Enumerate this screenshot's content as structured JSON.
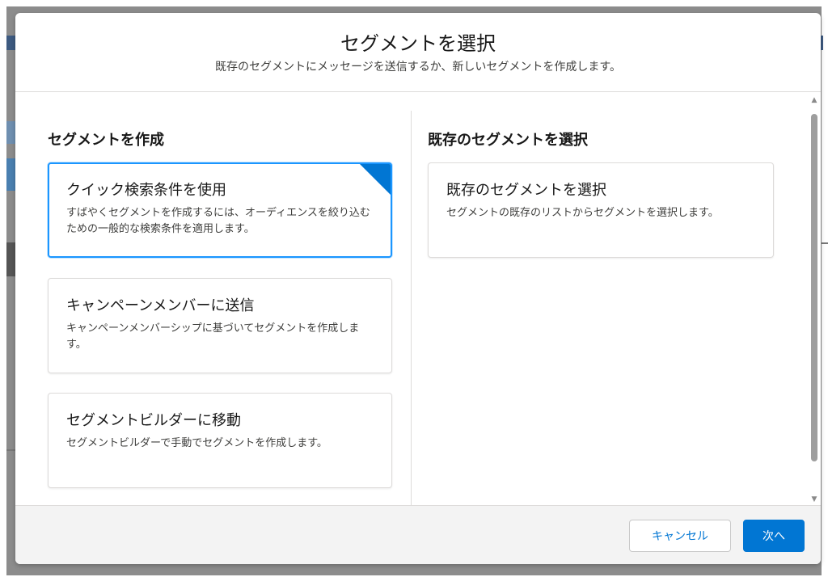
{
  "modal": {
    "title": "セグメントを選択",
    "subtitle": "既存のセグメントにメッセージを送信するか、新しいセグメントを作成します。"
  },
  "create_section": {
    "heading": "セグメントを作成",
    "options": [
      {
        "title": "クイック検索条件を使用",
        "description": "すばやくセグメントを作成するには、オーディエンスを絞り込むための一般的な検索条件を適用します。",
        "selected": true
      },
      {
        "title": "キャンペーンメンバーに送信",
        "description": "キャンペーンメンバーシップに基づいてセグメントを作成します。",
        "selected": false
      },
      {
        "title": "セグメントビルダーに移動",
        "description": "セグメントビルダーで手動でセグメントを作成します。",
        "selected": false
      }
    ]
  },
  "existing_section": {
    "heading": "既存のセグメントを選択",
    "options": [
      {
        "title": "既存のセグメントを選択",
        "description": "セグメントの既存のリストからセグメントを選択します。",
        "selected": false
      }
    ]
  },
  "footer": {
    "cancel_label": "キャンセル",
    "next_label": "次へ"
  },
  "icons": {
    "scroll_up": "scroll-up-arrow-icon",
    "scroll_down": "scroll-down-arrow-icon",
    "selected_corner": "selected-corner-indicator-icon"
  },
  "colors": {
    "brand": "#0176d3",
    "selected_border": "#1b96ff",
    "footer_bg": "#f3f3f3"
  }
}
